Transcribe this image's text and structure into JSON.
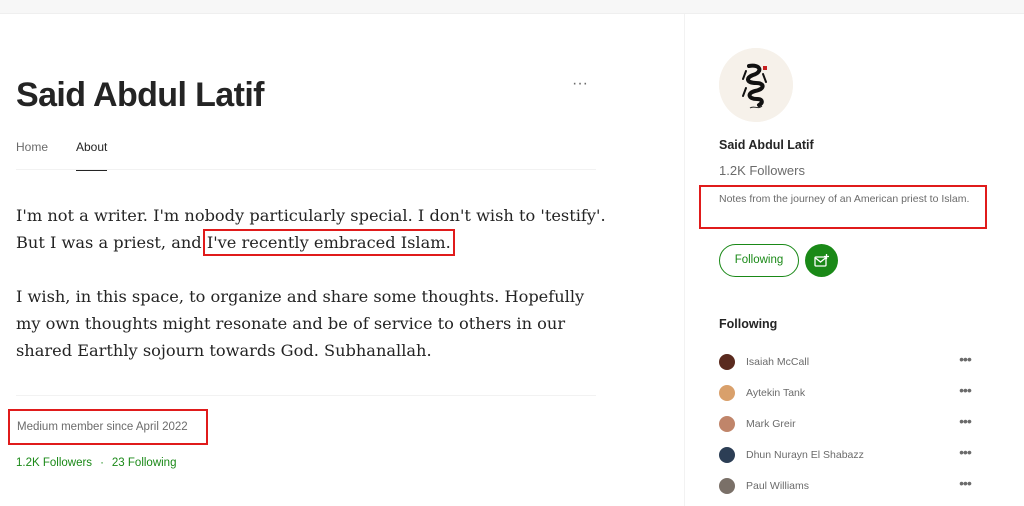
{
  "profile": {
    "name": "Said Abdul Latif",
    "more_icon_glyph": "···"
  },
  "tabs": [
    {
      "label": "Home",
      "active": false
    },
    {
      "label": "About",
      "active": true
    }
  ],
  "bio": {
    "p1_before": "I'm not a writer. I'm nobody particularly special. I don't wish to 'testify'. But I was a priest, and ",
    "p1_highlight": "I've recently embraced Islam.",
    "p2": "I wish, in this space, to organize and share some thoughts. Hopefully my own thoughts might resonate and be of service to others in our shared Earthly sojourn towards God. Subhanallah."
  },
  "member_since": "Medium member since April 2022",
  "stats": {
    "followers": "1.2K Followers",
    "separator": "·",
    "following": "23 Following"
  },
  "sidebar": {
    "name": "Said Abdul Latif",
    "followers": "1.2K Followers",
    "description": "Notes from the journey of an American priest to Islam.",
    "following_button": "Following",
    "subscribe_icon": "mail-plus-icon",
    "following_heading": "Following",
    "following_list": [
      {
        "name": "Isaiah McCall",
        "avatar_color": "#5a2a1e"
      },
      {
        "name": "Aytekin Tank",
        "avatar_color": "#d9a06b"
      },
      {
        "name": "Mark Greir",
        "avatar_color": "#c0856a"
      },
      {
        "name": "Dhun Nurayn El Shabazz",
        "avatar_color": "#2c3e55"
      },
      {
        "name": "Paul Williams",
        "avatar_color": "#7a7068"
      }
    ],
    "item_more_glyph": "•••"
  },
  "colors": {
    "accent_green": "#1a8917",
    "highlight_red": "#e01b1b",
    "text_primary": "#242424",
    "text_secondary": "#6b6b6b"
  }
}
